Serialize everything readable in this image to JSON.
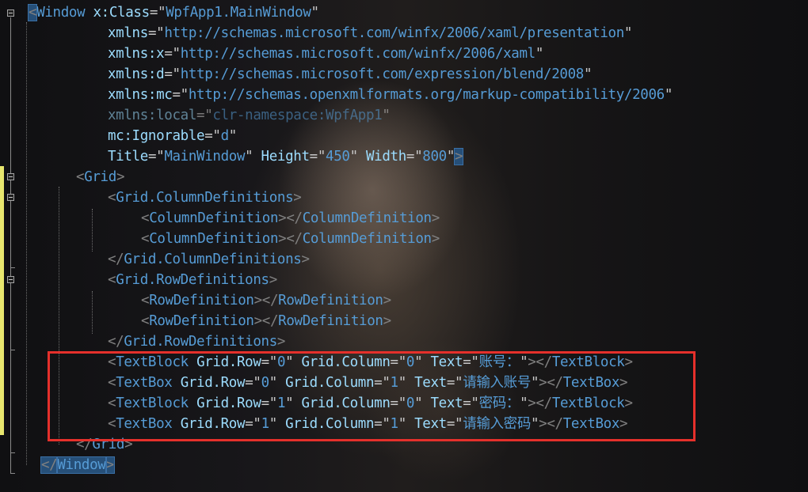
{
  "editor": {
    "lines": [
      [
        [
          "b",
          "<"
        ],
        [
          "t",
          "Window"
        ],
        [
          "q",
          " "
        ],
        [
          "a",
          "x:Class"
        ],
        [
          "q",
          "=\""
        ],
        [
          "v",
          "WpfApp1.MainWindow"
        ],
        [
          "q",
          "\""
        ]
      ],
      [
        [
          "a",
          "xmlns"
        ],
        [
          "q",
          "=\""
        ],
        [
          "v",
          "http://schemas.microsoft.com/winfx/2006/xaml/presentation"
        ],
        [
          "q",
          "\""
        ]
      ],
      [
        [
          "a",
          "xmlns:x"
        ],
        [
          "q",
          "=\""
        ],
        [
          "v",
          "http://schemas.microsoft.com/winfx/2006/xaml"
        ],
        [
          "q",
          "\""
        ]
      ],
      [
        [
          "a",
          "xmlns:d"
        ],
        [
          "q",
          "=\""
        ],
        [
          "v",
          "http://schemas.microsoft.com/expression/blend/2008"
        ],
        [
          "q",
          "\""
        ]
      ],
      [
        [
          "a",
          "xmlns:mc"
        ],
        [
          "q",
          "=\""
        ],
        [
          "v",
          "http://schemas.openxmlformats.org/markup-compatibility/2006"
        ],
        [
          "q",
          "\""
        ]
      ],
      [
        [
          "a",
          "xmlns:local"
        ],
        [
          "q",
          "=\""
        ],
        [
          "v",
          "clr-namespace:WpfApp1"
        ],
        [
          "q",
          "\""
        ]
      ],
      [
        [
          "a",
          "mc:Ignorable"
        ],
        [
          "q",
          "=\""
        ],
        [
          "v",
          "d"
        ],
        [
          "q",
          "\""
        ]
      ],
      [
        [
          "a",
          "Title"
        ],
        [
          "q",
          "=\""
        ],
        [
          "v",
          "MainWindow"
        ],
        [
          "q",
          "\" "
        ],
        [
          "a",
          "Height"
        ],
        [
          "q",
          "=\""
        ],
        [
          "v",
          "450"
        ],
        [
          "q",
          "\" "
        ],
        [
          "a",
          "Width"
        ],
        [
          "q",
          "=\""
        ],
        [
          "v",
          "800"
        ],
        [
          "q",
          "\""
        ],
        [
          "b",
          ">"
        ]
      ],
      [
        [
          "b",
          "<"
        ],
        [
          "t",
          "Grid"
        ],
        [
          "b",
          ">"
        ]
      ],
      [
        [
          "b",
          "<"
        ],
        [
          "t",
          "Grid.ColumnDefinitions"
        ],
        [
          "b",
          ">"
        ]
      ],
      [
        [
          "b",
          "<"
        ],
        [
          "t",
          "ColumnDefinition"
        ],
        [
          "b",
          "></"
        ],
        [
          "t",
          "ColumnDefinition"
        ],
        [
          "b",
          ">"
        ]
      ],
      [
        [
          "b",
          "<"
        ],
        [
          "t",
          "ColumnDefinition"
        ],
        [
          "b",
          "></"
        ],
        [
          "t",
          "ColumnDefinition"
        ],
        [
          "b",
          ">"
        ]
      ],
      [
        [
          "b",
          "</"
        ],
        [
          "t",
          "Grid.ColumnDefinitions"
        ],
        [
          "b",
          ">"
        ]
      ],
      [
        [
          "b",
          "<"
        ],
        [
          "t",
          "Grid.RowDefinitions"
        ],
        [
          "b",
          ">"
        ]
      ],
      [
        [
          "b",
          "<"
        ],
        [
          "t",
          "RowDefinition"
        ],
        [
          "b",
          "></"
        ],
        [
          "t",
          "RowDefinition"
        ],
        [
          "b",
          ">"
        ]
      ],
      [
        [
          "b",
          "<"
        ],
        [
          "t",
          "RowDefinition"
        ],
        [
          "b",
          "></"
        ],
        [
          "t",
          "RowDefinition"
        ],
        [
          "b",
          ">"
        ]
      ],
      [
        [
          "b",
          "</"
        ],
        [
          "t",
          "Grid.RowDefinitions"
        ],
        [
          "b",
          ">"
        ]
      ],
      [
        [
          "b",
          "<"
        ],
        [
          "t",
          "TextBlock"
        ],
        [
          "q",
          " "
        ],
        [
          "a",
          "Grid.Row"
        ],
        [
          "q",
          "=\""
        ],
        [
          "v",
          "0"
        ],
        [
          "q",
          "\" "
        ],
        [
          "a",
          "Grid.Column"
        ],
        [
          "q",
          "=\""
        ],
        [
          "v",
          "0"
        ],
        [
          "q",
          "\" "
        ],
        [
          "a",
          "Text"
        ],
        [
          "q",
          "=\""
        ],
        [
          "v",
          "账号："
        ],
        [
          "q",
          "\""
        ],
        [
          "b",
          "></"
        ],
        [
          "t",
          "TextBlock"
        ],
        [
          "b",
          ">"
        ]
      ],
      [
        [
          "b",
          "<"
        ],
        [
          "t",
          "TextBox"
        ],
        [
          "q",
          " "
        ],
        [
          "a",
          "Grid.Row"
        ],
        [
          "q",
          "=\""
        ],
        [
          "v",
          "0"
        ],
        [
          "q",
          "\" "
        ],
        [
          "a",
          "Grid.Column"
        ],
        [
          "q",
          "=\""
        ],
        [
          "v",
          "1"
        ],
        [
          "q",
          "\" "
        ],
        [
          "a",
          "Text"
        ],
        [
          "q",
          "=\""
        ],
        [
          "v",
          "请输入账号"
        ],
        [
          "q",
          "\""
        ],
        [
          "b",
          "></"
        ],
        [
          "t",
          "TextBox"
        ],
        [
          "b",
          ">"
        ]
      ],
      [
        [
          "b",
          "<"
        ],
        [
          "t",
          "TextBlock"
        ],
        [
          "q",
          " "
        ],
        [
          "a",
          "Grid.Row"
        ],
        [
          "q",
          "=\""
        ],
        [
          "v",
          "1"
        ],
        [
          "q",
          "\" "
        ],
        [
          "a",
          "Grid.Column"
        ],
        [
          "q",
          "=\""
        ],
        [
          "v",
          "0"
        ],
        [
          "q",
          "\" "
        ],
        [
          "a",
          "Text"
        ],
        [
          "q",
          "=\""
        ],
        [
          "v",
          "密码："
        ],
        [
          "q",
          "\""
        ],
        [
          "b",
          "></"
        ],
        [
          "t",
          "TextBlock"
        ],
        [
          "b",
          ">"
        ]
      ],
      [
        [
          "b",
          "<"
        ],
        [
          "t",
          "TextBox"
        ],
        [
          "q",
          " "
        ],
        [
          "a",
          "Grid.Row"
        ],
        [
          "q",
          "=\""
        ],
        [
          "v",
          "1"
        ],
        [
          "q",
          "\" "
        ],
        [
          "a",
          "Grid.Column"
        ],
        [
          "q",
          "=\""
        ],
        [
          "v",
          "1"
        ],
        [
          "q",
          "\" "
        ],
        [
          "a",
          "Text"
        ],
        [
          "q",
          "=\""
        ],
        [
          "v",
          "请输入密码"
        ],
        [
          "q",
          "\""
        ],
        [
          "b",
          "></"
        ],
        [
          "t",
          "TextBox"
        ],
        [
          "b",
          ">"
        ]
      ],
      [
        [
          "b",
          "</"
        ],
        [
          "t",
          "Grid"
        ],
        [
          "b",
          ">"
        ]
      ],
      [
        [
          "b",
          "</"
        ],
        [
          "t",
          "Window"
        ],
        [
          "b",
          ">"
        ]
      ]
    ]
  },
  "colors": {
    "bracket": "#808080",
    "tag": "#569cd6",
    "attribute": "#9cdcfe",
    "value": "#569cd6",
    "highlight_box": "#e5302b",
    "change_bar": "#e8e76e"
  }
}
